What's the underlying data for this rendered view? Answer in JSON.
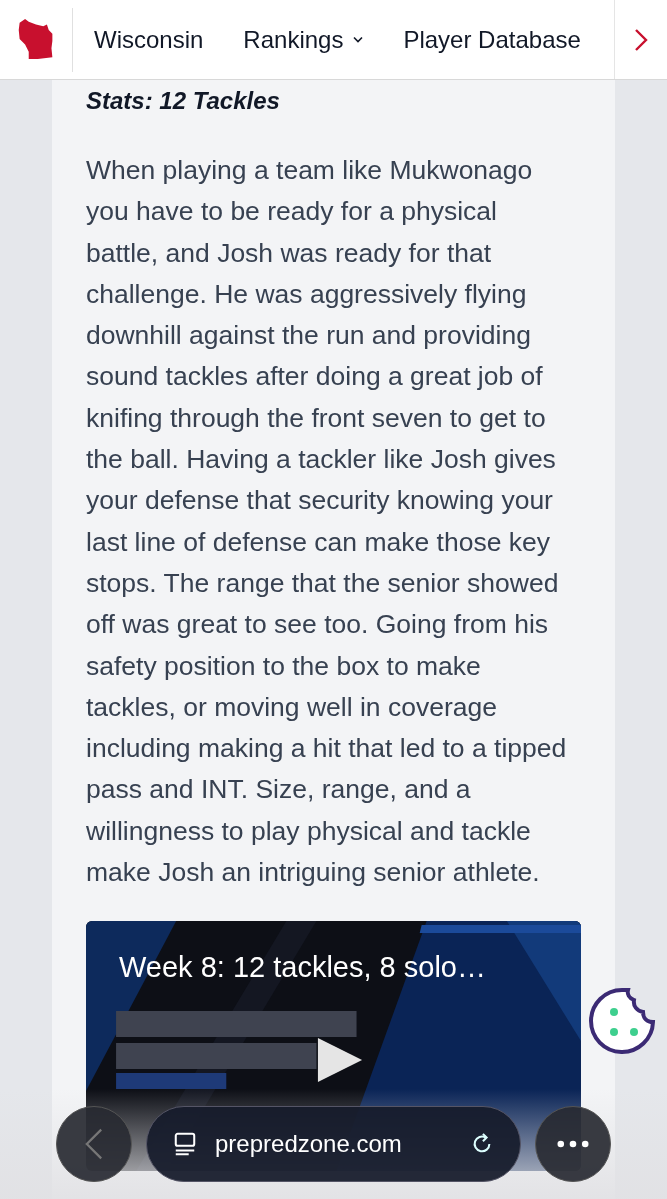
{
  "nav": {
    "items": [
      {
        "label": "Wisconsin",
        "dropdown": false
      },
      {
        "label": "Rankings",
        "dropdown": true
      },
      {
        "label": "Player Database",
        "dropdown": false
      }
    ]
  },
  "article": {
    "heading": "Stats: 12 Tackles",
    "body": "When playing a team like Mukwonago you have to be ready for a physical battle, and Josh was ready for that challenge. He was aggressively flying downhill against the run and providing sound tackles after doing a great job of knifing through the front seven to get to the ball. Having a tackler like Josh gives your defense that security knowing your last line of defense can make those key stops. The range that the senior showed off was great to see too. Going from his safety position to the box to make tackles, or moving well in coverage including making a hit that led to a tipped pass and INT. Size, range, and a willingness to play physical and tackle make Josh an intriguing senior athlete."
  },
  "video": {
    "title": "Week 8: 12 tackles, 8 solo…",
    "kind": "picture"
  },
  "browser": {
    "url": "prepredzone.com"
  }
}
